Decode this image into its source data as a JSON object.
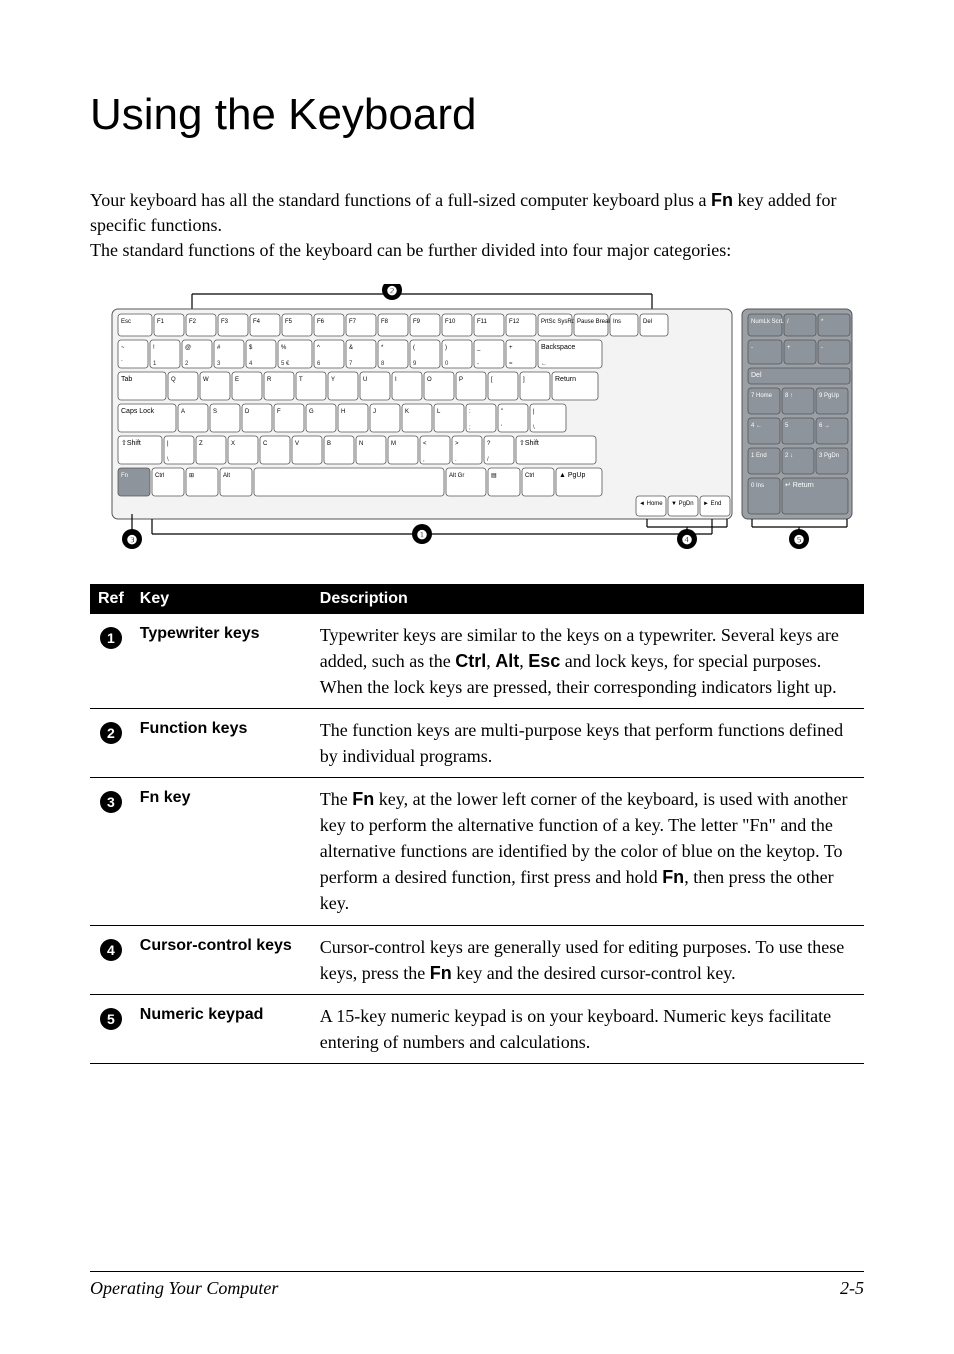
{
  "title": "Using the Keyboard",
  "intro_prefix": "Your keyboard has all the standard functions of a full-sized computer keyboard plus a ",
  "intro_fn": "Fn",
  "intro_suffix": " key added for specific functions.",
  "intro_line2": "The standard functions of the keyboard can be further divided into four major categories:",
  "table": {
    "header": {
      "ref": "Ref",
      "key": "Key",
      "desc": "Description"
    },
    "rows": [
      {
        "num": "❶",
        "key": "Typewriter keys",
        "desc_parts": [
          "Typewriter keys are similar to the keys on a typewriter. Several keys are added, such as the ",
          "Ctrl",
          ", ",
          "Alt",
          ", ",
          "Esc",
          " and lock keys, for special purposes. When the lock keys are pressed, their corresponding indicators light up."
        ]
      },
      {
        "num": "❷",
        "key": "Function keys",
        "desc_parts": [
          "The function keys are multi-purpose keys that perform functions defined by individual programs."
        ]
      },
      {
        "num": "❸",
        "key_parts": [
          "Fn",
          " key"
        ],
        "desc_parts": [
          "The ",
          "Fn",
          " key, at the lower left corner of the keyboard, is used with another key to perform the alternative function of a key. ",
          "The letter \"Fn\" and the alternative functions are identified",
          " by the color of blue on the keytop. To perform a desired function, first press and hold ",
          "Fn",
          ", then press the other key."
        ]
      },
      {
        "num": "❹",
        "key": "Cursor-control keys",
        "desc_parts": [
          "Cursor-control keys are generally used for editing purposes. To use these keys, press the ",
          "Fn",
          " key and the desired cursor-control key."
        ]
      },
      {
        "num": "❺",
        "key": "Numeric keypad",
        "desc_parts": [
          "A 15-key numeric keypad is on your keyboard. Numeric keys facilitate entering of numbers and calculations."
        ]
      }
    ]
  },
  "footer": {
    "left": "Operating Your Computer",
    "right": "2-5"
  },
  "keyboard": {
    "function_row": [
      "Esc",
      "F1",
      "F2",
      "F3",
      "F4",
      "F5",
      "F6",
      "F7",
      "F8",
      "F9",
      "F10",
      "F11",
      "F12",
      "PrtSc SysRq",
      "Pause Break",
      "Ins",
      "Del"
    ],
    "number_row_top": [
      "~",
      "!",
      "@",
      "#",
      "$",
      "%",
      "^",
      "&",
      "*",
      "(",
      ")",
      "_",
      "+",
      "Backspace"
    ],
    "number_row_bottom": [
      "`",
      "1",
      "2",
      "3",
      "4",
      "5 €",
      "6",
      "7",
      "8",
      "9",
      "0",
      "-",
      "=",
      " ←"
    ],
    "qwerty_row": [
      "Tab",
      "Q",
      "W",
      "E",
      "R",
      "T",
      "Y",
      "U",
      "I",
      "O",
      "P",
      "[",
      "]",
      "Return"
    ],
    "asdf_row_top": [
      "Caps Lock",
      "A",
      "S",
      "D",
      "F",
      "G",
      "H",
      "J",
      "K",
      "L",
      ":",
      "\"",
      "|"
    ],
    "asdf_row_bottom": [
      "",
      "",
      "",
      "",
      "",
      "",
      "",
      "",
      "",
      "",
      ";",
      "'",
      "\\"
    ],
    "zxcv_row_top": [
      "⇧Shift",
      "|",
      "Z",
      "X",
      "C",
      "V",
      "B",
      "N",
      "M",
      "<",
      ">",
      "?",
      "⇧Shift"
    ],
    "zxcv_row_bottom": [
      "",
      "\\",
      "",
      "",
      "",
      "",
      "",
      "",
      "",
      ",",
      ".",
      "/",
      ""
    ],
    "bottom_row": [
      "Fn",
      "Ctrl",
      "⊞",
      "Alt",
      " ",
      "Alt Gr",
      "▤",
      "Ctrl",
      "▲ PgUp"
    ],
    "bottom_arrows": [
      "◄ Home",
      "▼ PgDn",
      "► End"
    ],
    "numpad_top": [
      "NumLk ScrLk",
      "/",
      "*"
    ],
    "numpad_r1": [
      "-",
      "+",
      "-"
    ],
    "numpad_r2": [
      "Del"
    ],
    "numpad_r3": [
      "7 Home",
      "8 ↑",
      "9 PgUp"
    ],
    "numpad_r4": [
      "4 ←",
      "5",
      "6 →"
    ],
    "numpad_r5": [
      "1 End",
      "2 ↓",
      "3 PgDn"
    ],
    "numpad_r6": [
      "0 Ins",
      "↵ Return"
    ]
  },
  "callouts": [
    "❶",
    "❷",
    "❸",
    "❹",
    "❺"
  ]
}
